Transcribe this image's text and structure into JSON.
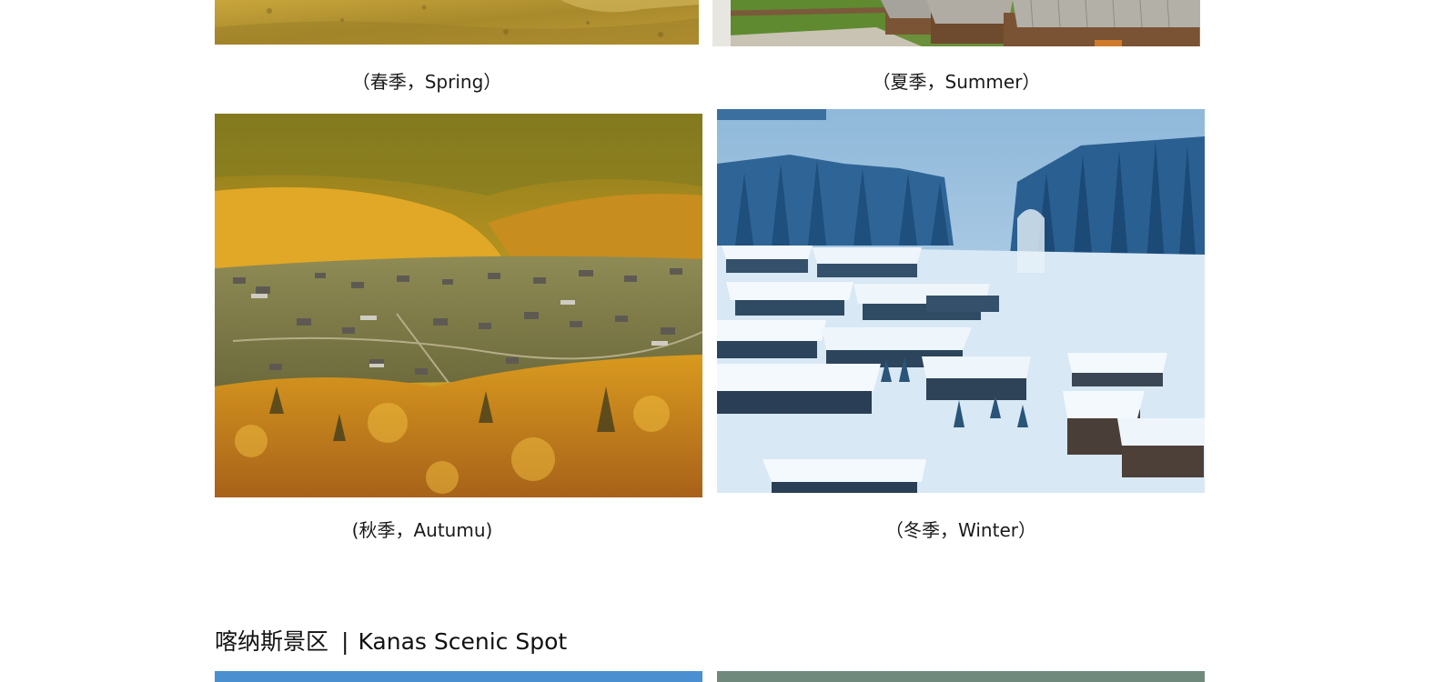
{
  "captions": {
    "spring": "（春季，Spring）",
    "summer": "（夏季，Summer）",
    "autumn": "(秋季，Autumu)",
    "winter": "（冬季，Winter）"
  },
  "section": {
    "title_cn": "喀纳斯景区",
    "separator": "|",
    "title_en": "Kanas Scenic Spot"
  },
  "colors": {
    "spring_grass": "#b9952e",
    "summer_roof": "#a8a8a2",
    "autumn_gold": "#d49a1f",
    "winter_blue": "#3f7fb4",
    "strip_blue": "#4a8fd0"
  }
}
